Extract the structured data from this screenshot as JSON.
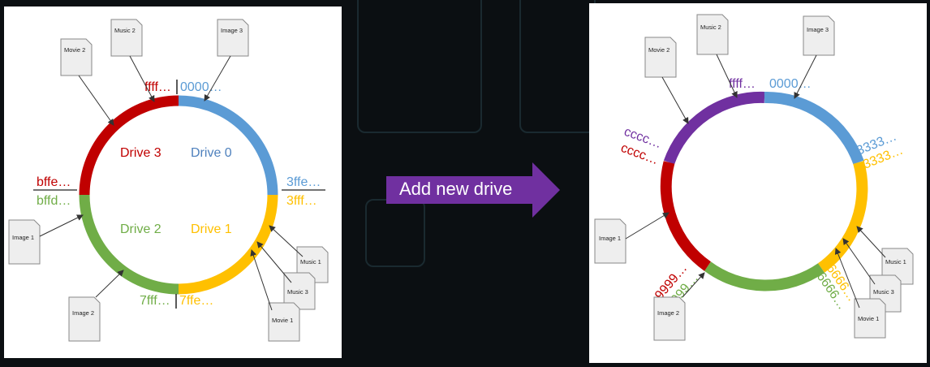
{
  "action": {
    "label": "Add new drive"
  },
  "colors": {
    "drive0": "#5b9bd5",
    "drive1": "#ffc000",
    "drive2": "#70ad47",
    "drive3": "#c00000",
    "drive4": "#7030a0",
    "arrow": "#7030a0"
  },
  "before": {
    "drives": [
      {
        "label": "Drive 0",
        "color": "drive0"
      },
      {
        "label": "Drive 1",
        "color": "drive1"
      },
      {
        "label": "Drive 2",
        "color": "drive2"
      },
      {
        "label": "Drive 3",
        "color": "drive3"
      }
    ],
    "boundaries": {
      "top_left": "ffff…",
      "top_right": "0000…",
      "right_upper": "3ffe…",
      "right_lower": "3fff…",
      "bottom_left": "7fff…",
      "bottom_right": "7ffe…",
      "left_upper": "bffe…",
      "left_lower": "bffd…"
    },
    "files": [
      "Music 2",
      "Movie 2",
      "Image 3",
      "Image 1",
      "Image 2",
      "Music 1",
      "Music 3",
      "Movie 1"
    ]
  },
  "after": {
    "boundaries": {
      "top_left": "ffff…",
      "top_right": "0000…",
      "right_upper": "3333…",
      "right_lower": "3333…",
      "left_upper": "cccc…",
      "left_lower": "cccc…",
      "bottom_left_upper": "9999…",
      "bottom_left_lower": "9999…",
      "bottom_right_upper": "6666…",
      "bottom_right_lower": "6666…"
    },
    "files": [
      "Music 2",
      "Movie 2",
      "Image 3",
      "Image 1",
      "Image 2",
      "Music 1",
      "Music 3",
      "Movie 1"
    ]
  }
}
